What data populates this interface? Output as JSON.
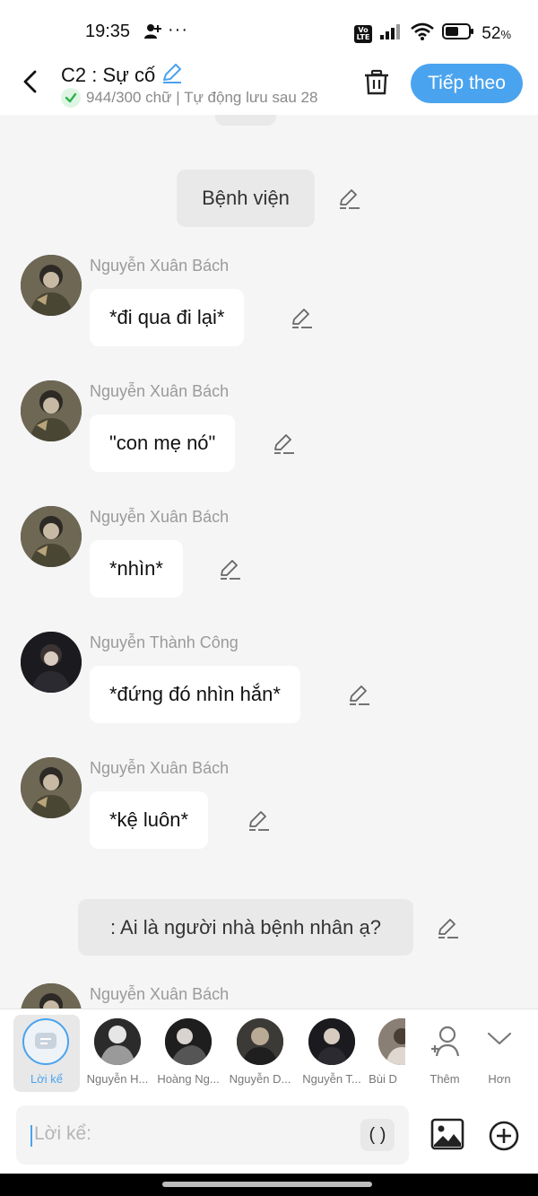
{
  "status": {
    "time": "19:35",
    "volte_top": "Vo",
    "volte_bottom": "LTE",
    "battery": "52",
    "battery_unit": "%"
  },
  "header": {
    "title": "C2 : Sự cố",
    "subtitle": "944/300 chữ | Tự động lưu sau 28",
    "next_label": "Tiếp theo"
  },
  "chat": {
    "narration_1": "Bệnh viện",
    "messages": [
      {
        "sender": "Nguyễn Xuân Bách",
        "text": "*đi qua đi lại*"
      },
      {
        "sender": "Nguyễn Xuân Bách",
        "text": "\"con mẹ nó\""
      },
      {
        "sender": "Nguyễn Xuân Bách",
        "text": "*nhìn*"
      },
      {
        "sender": "Nguyễn Thành Công",
        "text": "*đứng đó nhìn hắn*"
      },
      {
        "sender": "Nguyễn Xuân Bách",
        "text": "*kệ luôn*"
      }
    ],
    "narration_2": ": Ai là người nhà bệnh nhân ạ?",
    "partial_sender": "Nguyễn Xuân Bách"
  },
  "characters": {
    "narrator_label": "Lời kể",
    "items": [
      {
        "label": "Nguyễn H..."
      },
      {
        "label": "Hoàng Ng..."
      },
      {
        "label": "Nguyễn D..."
      },
      {
        "label": "Nguyễn T..."
      },
      {
        "label": "Bùi D"
      }
    ],
    "add_label": "Thêm",
    "more_label": "Hơn"
  },
  "input": {
    "placeholder": "Lời kể:",
    "paren_label": "( )"
  },
  "colors": {
    "accent": "#4aa3ee",
    "background": "#f5f5f5",
    "bubble": "#ffffff",
    "narration": "#e9e9e9"
  }
}
